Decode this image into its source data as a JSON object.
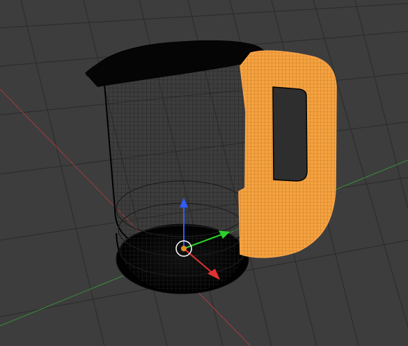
{
  "viewport": {
    "background_color": "#3d3d3d",
    "grid_line_color": "#2a2a2a",
    "x_axis_color": "#a23c3c",
    "y_axis_color": "#3a8f3a",
    "scene_objects": [
      {
        "name": "jug-body",
        "mode": "wireframe",
        "color": "#000000"
      },
      {
        "name": "jug-handle",
        "mode": "wireframe-selected",
        "color": "#f7a34a"
      }
    ],
    "gizmo": {
      "z_arrow_color": "#2f5bff",
      "y_arrow_color": "#2bd02b",
      "x_arrow_color": "#e23232",
      "center_color": "#ffffff"
    }
  }
}
